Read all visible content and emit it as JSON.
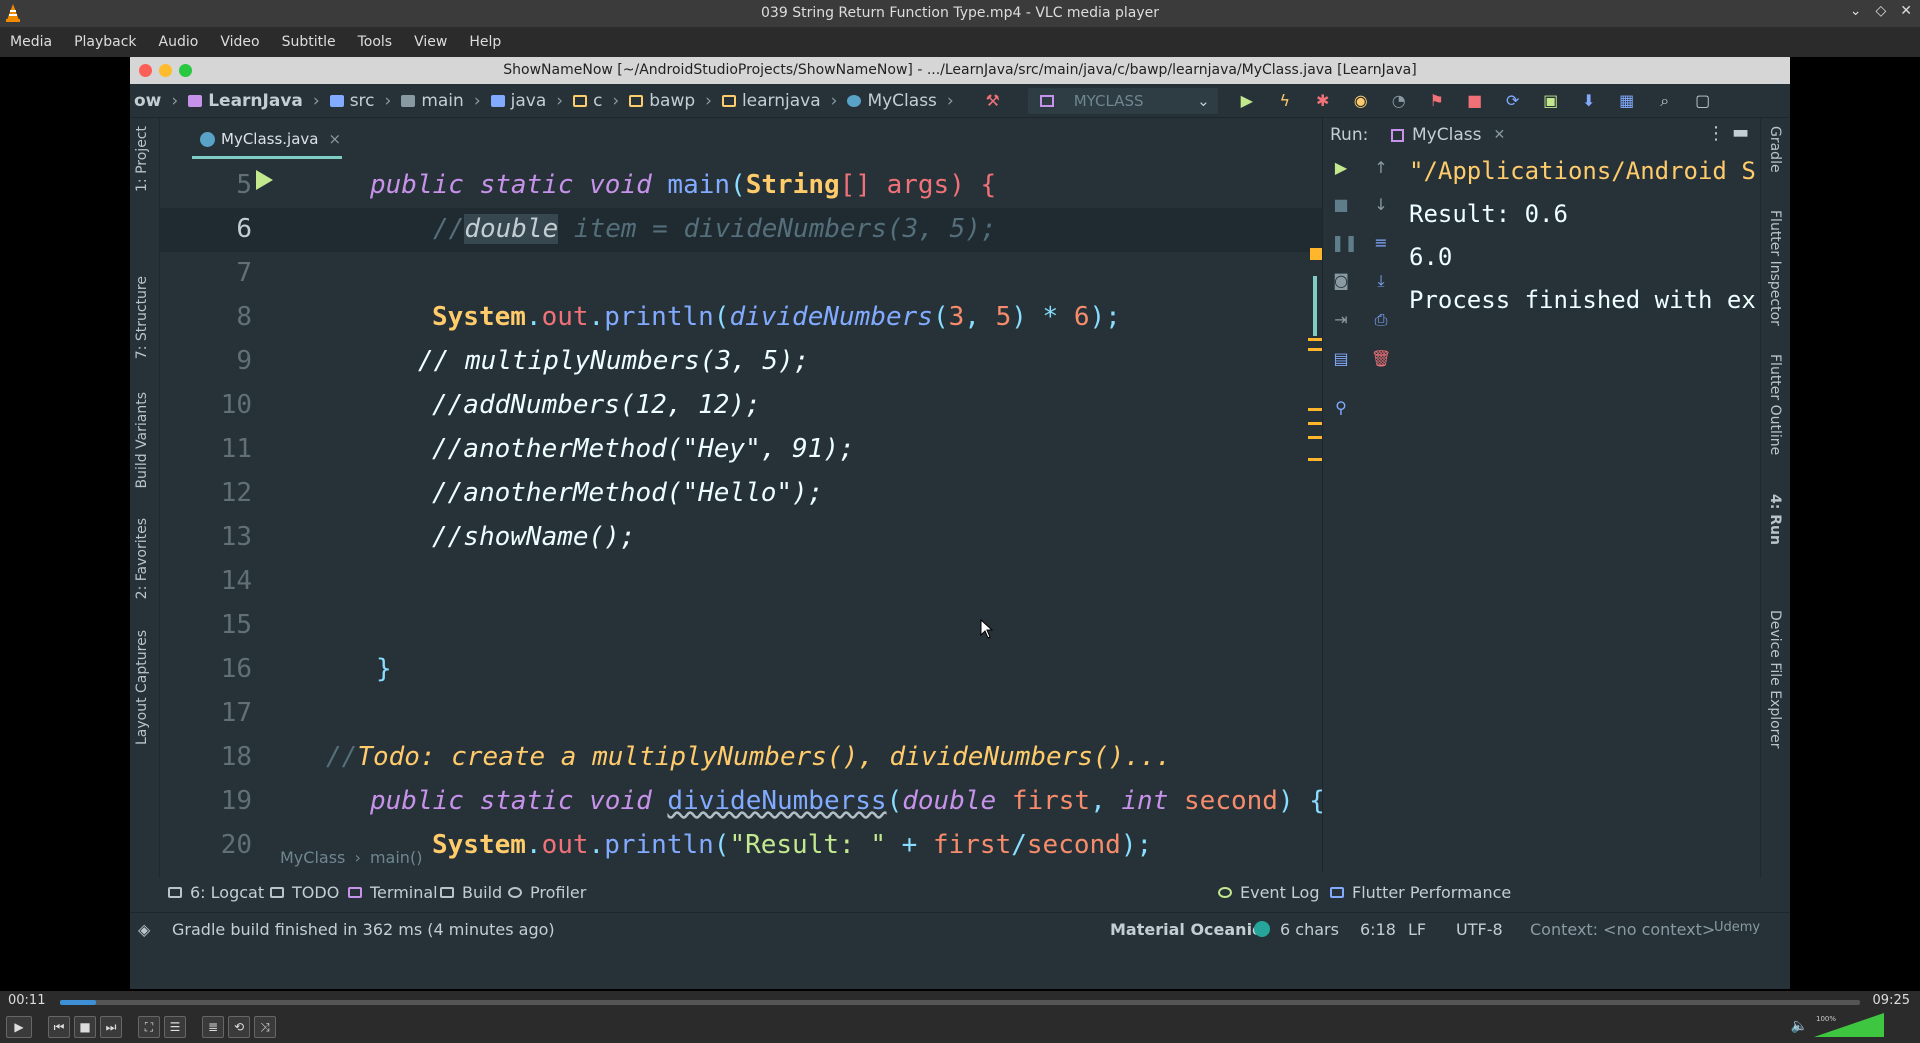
{
  "vlc": {
    "window_title": "039 String Return Function Type.mp4 - VLC media player",
    "menu": [
      "Media",
      "Playback",
      "Audio",
      "Video",
      "Subtitle",
      "Tools",
      "View",
      "Help"
    ],
    "time_elapsed": "00:11",
    "time_total": "09:25",
    "progress_fraction": 0.02,
    "volume_label": "100%",
    "volume_fraction": 1.0
  },
  "ide": {
    "window_title": "ShowNameNow [~/AndroidStudioProjects/ShowNameNow] - .../LearnJava/src/main/java/c/bawp/learnjava/MyClass.java [LearnJava]",
    "nav_crumbs": [
      "ow",
      "LearnJava",
      "src",
      "main",
      "java",
      "c",
      "bawp",
      "learnjava",
      "MyClass"
    ],
    "run_config": "MYCLASS",
    "left_tabs": [
      "1: Project",
      "7: Structure",
      "Build Variants",
      "2: Favorites",
      "Layout Captures"
    ],
    "right_tabs": [
      "Gradle",
      "Flutter Inspector",
      "Flutter Outline",
      "4: Run",
      "Device File Explorer"
    ],
    "file_tab": "MyClass.java",
    "code_lines": [
      {
        "n": "5"
      },
      {
        "n": "6"
      },
      {
        "n": "7"
      },
      {
        "n": "8"
      },
      {
        "n": "9"
      },
      {
        "n": "10"
      },
      {
        "n": "11"
      },
      {
        "n": "12"
      },
      {
        "n": "13"
      },
      {
        "n": "14"
      },
      {
        "n": "15"
      },
      {
        "n": "16"
      },
      {
        "n": "17"
      },
      {
        "n": "18"
      },
      {
        "n": "19"
      },
      {
        "n": "20"
      }
    ],
    "code": {
      "l5": [
        "public static void ",
        "main",
        "(",
        "String",
        "[] args) {"
      ],
      "l6": [
        "//",
        "double",
        " item = divideNumbers(3, 5);"
      ],
      "l8": [
        "System",
        ".",
        "out",
        ".",
        "println",
        "(",
        "divideNumbers",
        "(",
        "3",
        ", ",
        "5",
        ") * ",
        "6",
        ");"
      ],
      "l9": "// multiplyNumbers(3, 5);",
      "l10": "//addNumbers(12, 12);",
      "l11": "//anotherMethod(\"Hey\", 91);",
      "l12": "//anotherMethod(\"Hello\");",
      "l13": "//showName();",
      "l16": "}",
      "l18": [
        "//",
        "Todo: create a multiplyNumbers(), divideNumbers()..."
      ],
      "l19": [
        "public static void ",
        "divideNumberss",
        "(",
        "double ",
        "first",
        ", ",
        "int ",
        "second",
        ") {"
      ],
      "l20": [
        "System",
        ".",
        "out",
        ".",
        "println",
        "(",
        "\"Result: \"",
        " + ",
        "first",
        "/",
        "second",
        ");"
      ]
    },
    "bottom_breadcrumb": [
      "MyClass",
      "main()"
    ],
    "run": {
      "label": "Run:",
      "tab": "MyClass",
      "console": [
        "\"/Applications/Android S",
        "Result: 0.6",
        "6.0",
        "",
        "Process finished with ex"
      ]
    },
    "tool_tabs": [
      "6: Logcat",
      "TODO",
      "Terminal",
      "Build",
      "Profiler",
      "Event Log",
      "Flutter Performance"
    ],
    "status": {
      "message": "Gradle build finished in 362 ms (4 minutes ago)",
      "theme": "Material Oceanic",
      "selection": "6 chars",
      "position": "6:18",
      "line_sep": "LF",
      "encoding": "UTF-8",
      "context": "Context: <no context>",
      "udemy": "Udemy"
    }
  }
}
